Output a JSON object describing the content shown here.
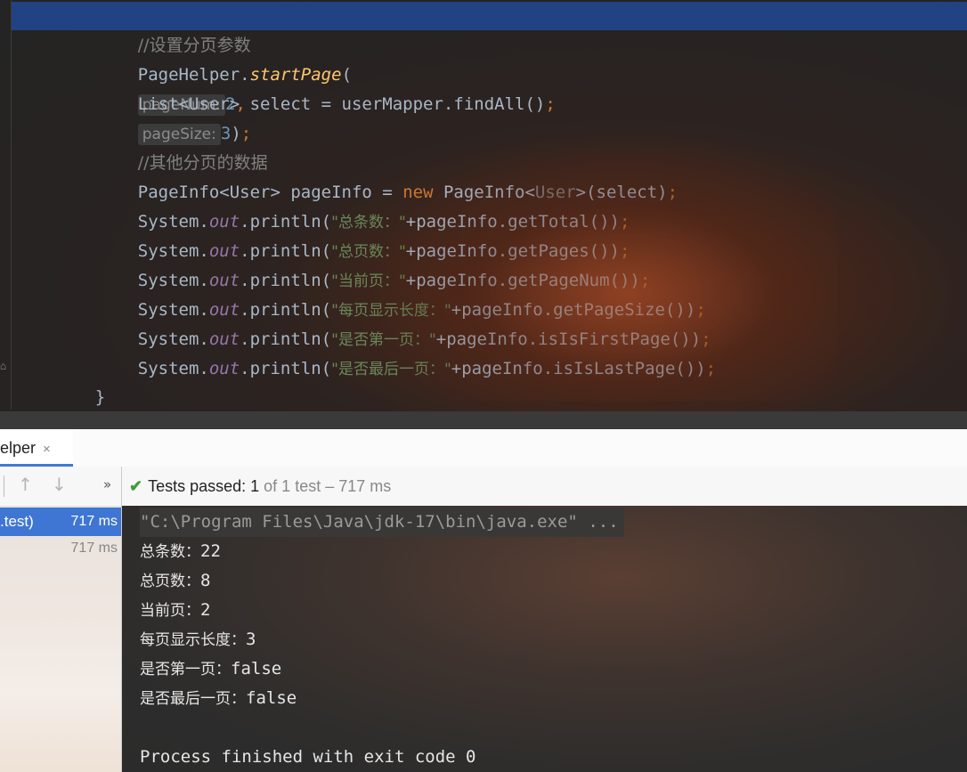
{
  "editor": {
    "lines": {
      "comment1": "//设置分页参数",
      "l2_obj": "PageHelper.",
      "l2_method": "startPage",
      "l2_open": "(",
      "l2_hint1": "pageNum:",
      "l2_val1": "2",
      "l2_comma": ",",
      "l2_hint2": "pageSize:",
      "l2_val2": "3",
      "l2_close": ")",
      "semi": ";",
      "l3": "List<User> select = userMapper.findAll()",
      "comment2": "//其他分页的数据",
      "l5_a": "PageInfo<User> pageInfo = ",
      "l5_new": "new",
      "l5_b": " PageInfo<",
      "l5_gen": "User",
      "l5_c": ">(select)",
      "sys": "System.",
      "out": "out",
      "println_open": ".println(",
      "p1_str": "\"总条数：\"",
      "p1_rest": "+pageInfo.getTotal())",
      "p2_str": "\"总页数：\"",
      "p2_rest": "+pageInfo.getPages())",
      "p3_str": "\"当前页：\"",
      "p3_rest": "+pageInfo.getPageNum())",
      "p4_str": "\"每页显示长度：\"",
      "p4_rest": "+pageInfo.getPageSize())",
      "p5_str": "\"是否第一页：\"",
      "p5_rest": "+pageInfo.isIsFirstPage())",
      "p6_str": "\"是否最后一页：\"",
      "p6_rest": "+pageInfo.isIsLastPage())",
      "brace_inner": "}",
      "brace_outer": "}"
    }
  },
  "tool_window": {
    "tab_label": "elper",
    "tab_close": "×",
    "more": "»",
    "status_prefix": "Tests passed: ",
    "status_count": "1",
    "status_suffix": " of 1 test – 717 ms"
  },
  "tree": {
    "rows": [
      {
        "label": ".test)",
        "time": "717 ms"
      },
      {
        "label": "",
        "time": "717 ms"
      }
    ]
  },
  "console": {
    "cmd": "\"C:\\Program Files\\Java\\jdk-17\\bin\\java.exe\" ...",
    "out1_label": "总条数：",
    "out1_val": "22",
    "out2_label": "总页数：",
    "out2_val": "8",
    "out3_label": "当前页：",
    "out3_val": "2",
    "out4_label": "每页显示长度：",
    "out4_val": "3",
    "out5_label": "是否第一页：",
    "out5_val": "false",
    "out6_label": "是否最后一页：",
    "out6_val": "false",
    "finish": "Process finished with exit code 0"
  }
}
